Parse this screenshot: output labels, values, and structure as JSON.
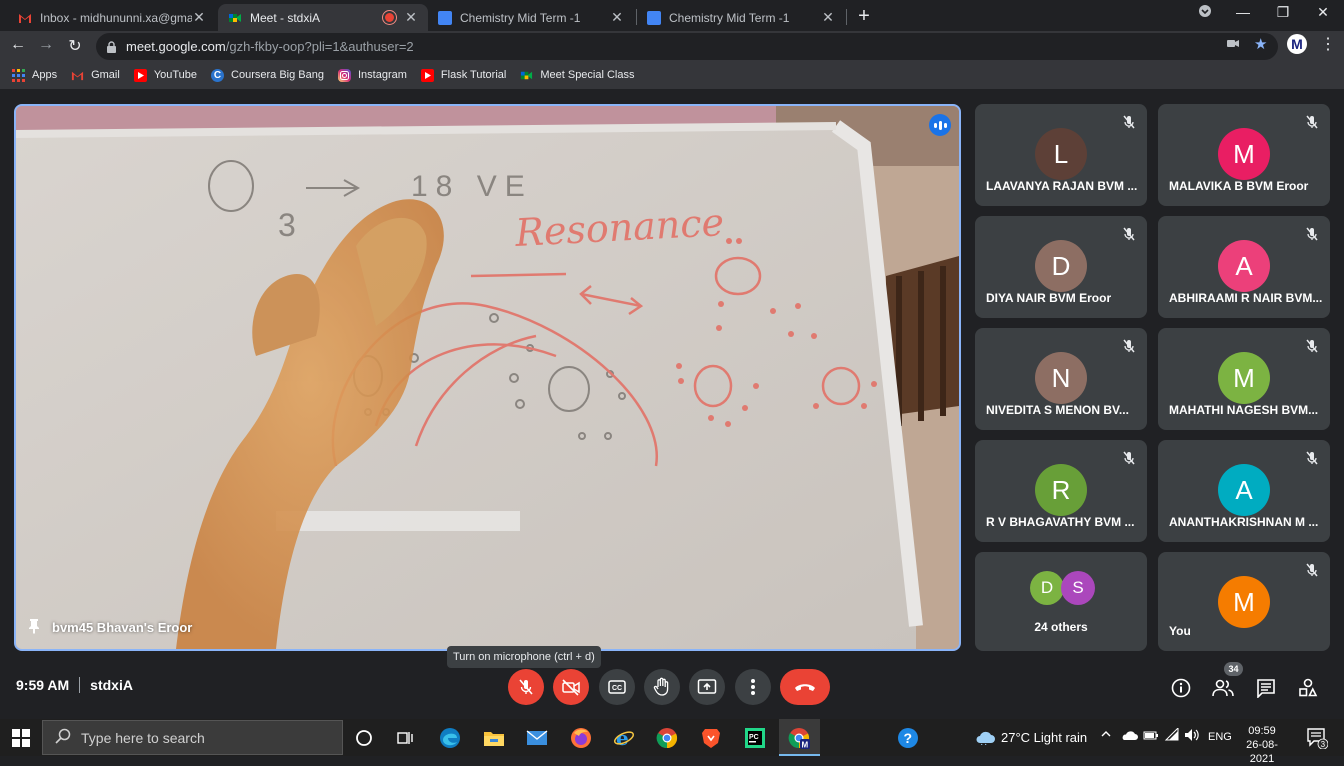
{
  "browser": {
    "tabs": [
      {
        "title": "Inbox - midhununni.xa@gmail.co",
        "favicon": "gmail-icon"
      },
      {
        "title": "Meet - stdxiA",
        "favicon": "meet-icon",
        "active": true,
        "recording": true
      },
      {
        "title": "Chemistry Mid Term -1",
        "favicon": "classroom-icon"
      },
      {
        "title": "Chemistry Mid Term -1",
        "favicon": "classroom-icon"
      }
    ],
    "url_main": "meet.google.com",
    "url_rest": "/gzh-fkby-oop?pli=1&authuser=2",
    "profile_initial": "M",
    "bookmarks": [
      {
        "label": "Apps",
        "icon": "apps-grid-icon"
      },
      {
        "label": "Gmail",
        "icon": "gmail-icon"
      },
      {
        "label": "YouTube",
        "icon": "youtube-icon"
      },
      {
        "label": "Coursera Big Bang",
        "icon": "coursera-icon"
      },
      {
        "label": "Instagram",
        "icon": "instagram-icon"
      },
      {
        "label": "Flask Tutorial",
        "icon": "youtube-icon"
      },
      {
        "label": "Meet Special Class",
        "icon": "meet-icon"
      }
    ]
  },
  "meet": {
    "presenter_name": "bvm45 Bhavan's Eroor",
    "participants": [
      {
        "initial": "L",
        "name": "LAAVANYA RAJAN BVM ...",
        "color": "#5d4037"
      },
      {
        "initial": "M",
        "name": "MALAVIKA B BVM Eroor",
        "color": "#e91e63"
      },
      {
        "initial": "D",
        "name": "DIYA NAIR BVM Eroor",
        "color": "#8d6e63"
      },
      {
        "initial": "A",
        "name": "ABHIRAAMI R NAIR BVM...",
        "color": "#ec407a"
      },
      {
        "initial": "N",
        "name": "NIVEDITA S MENON BV...",
        "color": "#8d6e63"
      },
      {
        "initial": "M",
        "name": "MAHATHI NAGESH BVM...",
        "color": "#7cb342"
      },
      {
        "initial": "R",
        "name": "R V BHAGAVATHY BVM ...",
        "color": "#689f38"
      },
      {
        "initial": "A",
        "name": "ANANTHAKRISHNAN M ...",
        "color": "#00acc1"
      }
    ],
    "others": {
      "label": "24 others",
      "initials": [
        "D",
        "S"
      ],
      "colors": [
        "#7cb342",
        "#ab47bc"
      ]
    },
    "you": {
      "initial": "M",
      "name": "You",
      "color": "#f57c00"
    },
    "tooltip": "Turn on microphone (ctrl + d)",
    "time": "9:59 AM",
    "meeting_code": "stdxiA",
    "participant_count": "34",
    "whiteboard": {
      "formula_main": "O",
      "formula_sub": "3",
      "arrow": "→",
      "valence": "18 VE",
      "title": "Resonance",
      "double_arrow": "↔"
    }
  },
  "taskbar": {
    "search_placeholder": "Type here to search",
    "weather": "27°C  Light rain",
    "language": "ENG",
    "time": "09:59",
    "date": "26-08-2021",
    "notifications": "3"
  }
}
